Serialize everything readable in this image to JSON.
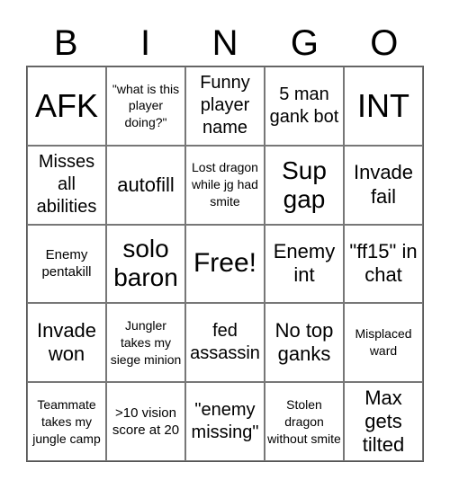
{
  "header": {
    "letters": [
      "B",
      "I",
      "N",
      "G",
      "O"
    ]
  },
  "cells": [
    [
      "AFK",
      "\"what is this player doing?\"",
      "Funny player name",
      "5 man gank bot",
      "INT"
    ],
    [
      "Misses all abilities",
      "autofill",
      "Lost dragon while jg had smite",
      "Sup gap",
      "Invade fail"
    ],
    [
      "Enemy pentakill",
      "solo baron",
      "Free!",
      "Enemy int",
      "\"ff15\" in chat"
    ],
    [
      "Invade won",
      "Jungler takes my siege minion",
      "fed assassin",
      "No top ganks",
      "Misplaced ward"
    ],
    [
      "Teammate takes my jungle camp",
      ">10 vision score at 20",
      "\"enemy missing\"",
      "Stolen dragon without smite",
      "Max gets tilted"
    ]
  ]
}
